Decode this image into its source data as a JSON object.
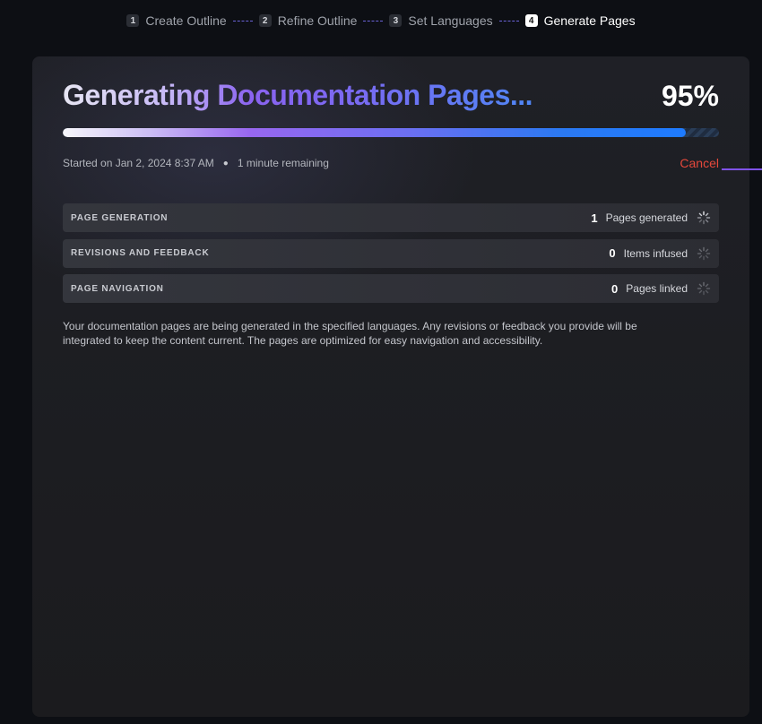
{
  "stepper": {
    "steps": [
      {
        "num": "1",
        "label": "Create Outline"
      },
      {
        "num": "2",
        "label": "Refine Outline"
      },
      {
        "num": "3",
        "label": "Set Languages"
      },
      {
        "num": "4",
        "label": "Generate Pages"
      }
    ],
    "active_step": 4
  },
  "main": {
    "title": "Generating Documentation Pages...",
    "percent_label": "95%",
    "progress": 0.95,
    "started": "Started on Jan 2, 2024 8:37 AM",
    "remaining": "1 minute remaining",
    "cancel_label": "Cancel",
    "rows": [
      {
        "label": "PAGE GENERATION",
        "count": "1",
        "unit": "Pages generated",
        "icon": "spinner-icon"
      },
      {
        "label": "REVISIONS AND FEEDBACK",
        "count": "0",
        "unit": "Items infused",
        "icon": "spinner-icon"
      },
      {
        "label": "PAGE NAVIGATION",
        "count": "0",
        "unit": "Pages linked",
        "icon": "spinner-icon"
      }
    ],
    "description": "Your documentation pages are being generated in the specified languages. Any revisions or feedback you provide will be integrated to keep the content current. The pages are optimized for easy navigation and accessibility."
  },
  "colors": {
    "background": "#0d0f14",
    "panel": "#1e1f24",
    "cancel": "#e5483b",
    "accent_purple": "#8a63f0",
    "accent_blue": "#1e7bff"
  }
}
